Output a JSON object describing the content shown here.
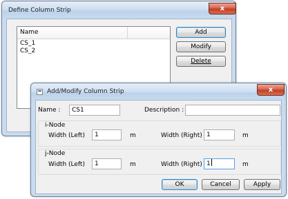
{
  "define_dialog": {
    "title": "Define Column Strip",
    "close_glyph": "x",
    "list_header_name": "Name",
    "items": [
      "CS_1",
      "CS_2"
    ],
    "buttons": {
      "add": "Add",
      "modify": "Modify",
      "delete": "Delete"
    }
  },
  "add_modify_dialog": {
    "title": "Add/Modify Column Strip",
    "close_glyph": "x",
    "name_label": "Name :",
    "name_value": "CS1",
    "description_label": "Description :",
    "description_value": "",
    "i_node": {
      "label": "i-Node",
      "width_left_label": "Width (Left)",
      "width_left_value": "1",
      "width_right_label": "Width (Right)",
      "width_right_value": "1",
      "unit": "m"
    },
    "j_node": {
      "label": "j-Node",
      "width_left_label": "Width (Left)",
      "width_left_value": "1",
      "width_right_label": "Width (Right)",
      "width_right_value": "1",
      "unit": "m"
    },
    "buttons": {
      "ok": "OK",
      "cancel": "Cancel",
      "apply": "Apply"
    }
  }
}
